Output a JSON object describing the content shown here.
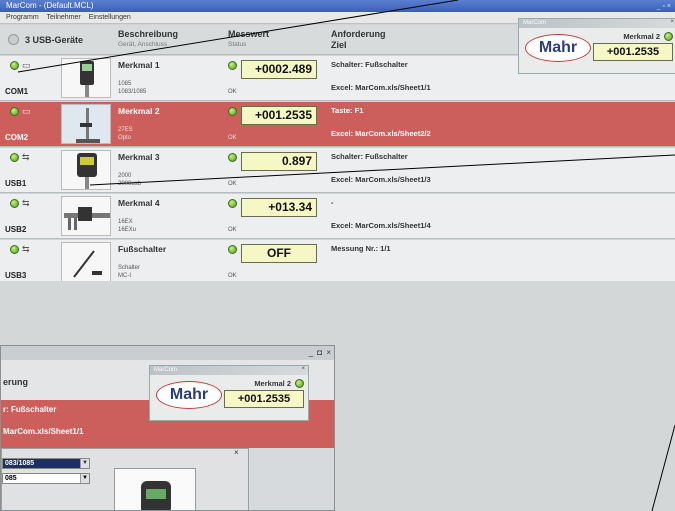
{
  "window": {
    "title": "MarCom - (Default.MCL)",
    "controls": "_ ▫ ×"
  },
  "menu": [
    "Programm",
    "Teilnehmer",
    "Einstellungen"
  ],
  "header": {
    "device_count": "3 USB-Geräte",
    "col_desc": "Beschreibung",
    "col_desc_sub": "Gerät, Anschluss",
    "col_value": "Messwert",
    "col_value_sub": "Status",
    "col_req": "Anforderung",
    "col_req_sub": "Ziel"
  },
  "rows": [
    {
      "port": "COM1",
      "conn": "RS232",
      "feature": "Merkmal 1",
      "model": "1085",
      "sub": "1083/1085",
      "status": "OK",
      "value": "+0002.489",
      "req1": "Schalter: Fußschalter",
      "req2": "Excel: MarCom.xls/Sheet1/1"
    },
    {
      "port": "COM2",
      "conn": "RS232",
      "feature": "Merkmal 2",
      "model": "27ES",
      "sub": "Opto",
      "status": "OK",
      "value": "+001.2535",
      "req1": "Taste: F1",
      "req2": "Excel: MarCom.xls/Sheet2/2"
    },
    {
      "port": "USB1",
      "conn": "USB",
      "feature": "Merkmal 3",
      "model": "2000",
      "sub": "2000usb",
      "status": "OK",
      "value": "0.897",
      "req1": "Schalter: Fußschalter",
      "req2": "Excel: MarCom.xls/Sheet1/3"
    },
    {
      "port": "USB2",
      "conn": "USB",
      "feature": "Merkmal 4",
      "model": "16EX",
      "sub": "16EXu",
      "status": "OK",
      "value": "+013.34",
      "req1": "-",
      "req2": "Excel: MarCom.xls/Sheet1/4"
    },
    {
      "port": "USB3",
      "conn": "USB",
      "feature": "Fußschalter",
      "model": "Schalter",
      "sub": "MC-I",
      "status": "OK",
      "value": "OFF",
      "req1": "Messung Nr.: 1/1",
      "req2": ""
    }
  ],
  "marcom_popup": {
    "title": "MarCom",
    "close": "×",
    "logo": "Mahr",
    "feature": "Merkmal 2",
    "value": "+001.2535"
  },
  "overlay": {
    "controls": "_ ◘ ×",
    "req_header": "erung",
    "red_line1": "r: Fußschalter",
    "red_line2": "MarCom.xls/Sheet1/1",
    "dialog_close": "×",
    "dropdown1": "083/1085",
    "dropdown2": "085"
  },
  "colors": {
    "selected_row": "#cc5f5c",
    "value_box": "#f5f7c4",
    "led_green": "#4c9a1d",
    "logo_ring": "#c23a3a",
    "logo_text": "#2b3d7a"
  }
}
